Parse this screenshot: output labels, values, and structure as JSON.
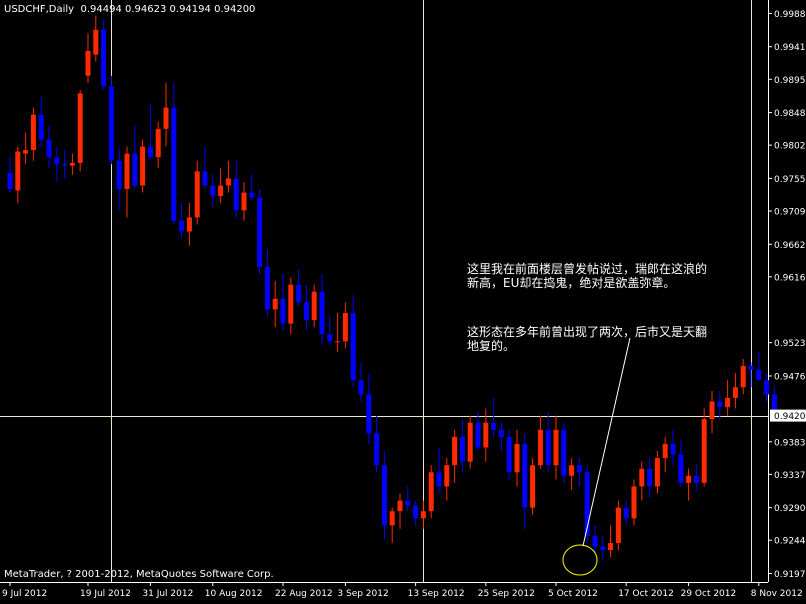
{
  "header": {
    "symbol": "USDCHF,Daily",
    "ohlc": "0.94494 0.94623 0.94194 0.94200"
  },
  "footer": {
    "copyright": "MetaTrader, ? 2001-2012, MetaQuotes Software Corp."
  },
  "annotations": {
    "note1": "这里我在前面楼层曾发帖说过，瑞郎在这浪的新高，EU却在捣鬼，绝对是欲盖弥章。",
    "note2": "这形态在多年前曾出现了两次，后市又是天翻地复的。"
  },
  "colors": {
    "background": "#000000",
    "bullish": "#ff2a00",
    "bearish": "#0000ff",
    "text": "#ffffff",
    "gridline": "#f0e6c8",
    "ellipse": "#ffff00"
  },
  "chart_data": {
    "type": "candlestick",
    "ylim": [
      0.9185,
      1.0007
    ],
    "y_ticks": [
      "0.99880",
      "0.99410",
      "0.98950",
      "0.98480",
      "0.98020",
      "0.97550",
      "0.97090",
      "0.96620",
      "0.96160",
      "0.95230",
      "0.94760",
      "0.93830",
      "0.93370",
      "0.92900",
      "0.92440",
      "0.91970"
    ],
    "current_price": "0.94200",
    "x_ticks": [
      {
        "label": "9 Jul 2012",
        "index": 0
      },
      {
        "label": "19 Jul 2012",
        "index": 10
      },
      {
        "label": "31 Jul 2012",
        "index": 18
      },
      {
        "label": "10 Aug 2012",
        "index": 26
      },
      {
        "label": "22 Aug 2012",
        "index": 35
      },
      {
        "label": "3 Sep 2012",
        "index": 43
      },
      {
        "label": "13 Sep 2012",
        "index": 52
      },
      {
        "label": "25 Sep 2012",
        "index": 61
      },
      {
        "label": "5 Oct 2012",
        "index": 70
      },
      {
        "label": "17 Oct 2012",
        "index": 79
      },
      {
        "label": "29 Oct 2012",
        "index": 87
      },
      {
        "label": "8 Nov 2012",
        "index": 96
      }
    ],
    "vertical_markers": [
      13,
      53,
      95
    ],
    "candles": [
      {
        "o": 0.9763,
        "h": 0.9785,
        "l": 0.9735,
        "c": 0.974
      },
      {
        "o": 0.9738,
        "h": 0.98,
        "l": 0.972,
        "c": 0.9793
      },
      {
        "o": 0.979,
        "h": 0.982,
        "l": 0.9775,
        "c": 0.9795
      },
      {
        "o": 0.9795,
        "h": 0.9855,
        "l": 0.978,
        "c": 0.9845
      },
      {
        "o": 0.9845,
        "h": 0.987,
        "l": 0.98,
        "c": 0.981
      },
      {
        "o": 0.981,
        "h": 0.983,
        "l": 0.977,
        "c": 0.9785
      },
      {
        "o": 0.9785,
        "h": 0.98,
        "l": 0.975,
        "c": 0.9775
      },
      {
        "o": 0.9775,
        "h": 0.9795,
        "l": 0.9755,
        "c": 0.9773
      },
      {
        "o": 0.9773,
        "h": 0.979,
        "l": 0.976,
        "c": 0.9777
      },
      {
        "o": 0.9777,
        "h": 0.988,
        "l": 0.9765,
        "c": 0.9875
      },
      {
        "o": 0.99,
        "h": 0.996,
        "l": 0.989,
        "c": 0.9935
      },
      {
        "o": 0.993,
        "h": 0.9985,
        "l": 0.992,
        "c": 0.9965
      },
      {
        "o": 0.9965,
        "h": 0.998,
        "l": 0.988,
        "c": 0.9885
      },
      {
        "o": 0.9885,
        "h": 0.99,
        "l": 0.9775,
        "c": 0.978
      },
      {
        "o": 0.978,
        "h": 0.98,
        "l": 0.971,
        "c": 0.974
      },
      {
        "o": 0.974,
        "h": 0.98,
        "l": 0.97,
        "c": 0.979
      },
      {
        "o": 0.979,
        "h": 0.983,
        "l": 0.974,
        "c": 0.9745
      },
      {
        "o": 0.9745,
        "h": 0.981,
        "l": 0.9735,
        "c": 0.98
      },
      {
        "o": 0.98,
        "h": 0.986,
        "l": 0.978,
        "c": 0.9785
      },
      {
        "o": 0.9785,
        "h": 0.9835,
        "l": 0.977,
        "c": 0.9825
      },
      {
        "o": 0.9825,
        "h": 0.989,
        "l": 0.98,
        "c": 0.9855
      },
      {
        "o": 0.9855,
        "h": 0.989,
        "l": 0.969,
        "c": 0.9695
      },
      {
        "o": 0.9695,
        "h": 0.972,
        "l": 0.967,
        "c": 0.968
      },
      {
        "o": 0.968,
        "h": 0.972,
        "l": 0.966,
        "c": 0.97
      },
      {
        "o": 0.97,
        "h": 0.978,
        "l": 0.969,
        "c": 0.9765
      },
      {
        "o": 0.9765,
        "h": 0.98,
        "l": 0.974,
        "c": 0.9745
      },
      {
        "o": 0.9745,
        "h": 0.976,
        "l": 0.9715,
        "c": 0.973
      },
      {
        "o": 0.973,
        "h": 0.977,
        "l": 0.972,
        "c": 0.9745
      },
      {
        "o": 0.9745,
        "h": 0.978,
        "l": 0.9735,
        "c": 0.9755
      },
      {
        "o": 0.9755,
        "h": 0.978,
        "l": 0.97,
        "c": 0.971
      },
      {
        "o": 0.971,
        "h": 0.975,
        "l": 0.9695,
        "c": 0.9735
      },
      {
        "o": 0.9735,
        "h": 0.976,
        "l": 0.9725,
        "c": 0.9728
      },
      {
        "o": 0.9728,
        "h": 0.974,
        "l": 0.962,
        "c": 0.963
      },
      {
        "o": 0.963,
        "h": 0.9655,
        "l": 0.956,
        "c": 0.957
      },
      {
        "o": 0.957,
        "h": 0.961,
        "l": 0.9545,
        "c": 0.9585
      },
      {
        "o": 0.9585,
        "h": 0.962,
        "l": 0.954,
        "c": 0.955
      },
      {
        "o": 0.955,
        "h": 0.9615,
        "l": 0.9535,
        "c": 0.9605
      },
      {
        "o": 0.9605,
        "h": 0.9625,
        "l": 0.9575,
        "c": 0.958
      },
      {
        "o": 0.958,
        "h": 0.9605,
        "l": 0.954,
        "c": 0.9555
      },
      {
        "o": 0.9555,
        "h": 0.9605,
        "l": 0.9545,
        "c": 0.9595
      },
      {
        "o": 0.9595,
        "h": 0.962,
        "l": 0.952,
        "c": 0.9535
      },
      {
        "o": 0.9535,
        "h": 0.956,
        "l": 0.952,
        "c": 0.9525
      },
      {
        "o": 0.9525,
        "h": 0.9565,
        "l": 0.951,
        "c": 0.9525
      },
      {
        "o": 0.9525,
        "h": 0.958,
        "l": 0.9515,
        "c": 0.9565
      },
      {
        "o": 0.9565,
        "h": 0.959,
        "l": 0.946,
        "c": 0.947
      },
      {
        "o": 0.947,
        "h": 0.9495,
        "l": 0.944,
        "c": 0.945
      },
      {
        "o": 0.945,
        "h": 0.948,
        "l": 0.938,
        "c": 0.9395
      },
      {
        "o": 0.9395,
        "h": 0.942,
        "l": 0.934,
        "c": 0.935
      },
      {
        "o": 0.935,
        "h": 0.937,
        "l": 0.9245,
        "c": 0.9265
      },
      {
        "o": 0.9265,
        "h": 0.929,
        "l": 0.924,
        "c": 0.9285
      },
      {
        "o": 0.9285,
        "h": 0.931,
        "l": 0.926,
        "c": 0.93
      },
      {
        "o": 0.93,
        "h": 0.932,
        "l": 0.9285,
        "c": 0.9293
      },
      {
        "o": 0.9293,
        "h": 0.93,
        "l": 0.9265,
        "c": 0.9275
      },
      {
        "o": 0.9275,
        "h": 0.93,
        "l": 0.926,
        "c": 0.9285
      },
      {
        "o": 0.9285,
        "h": 0.935,
        "l": 0.9275,
        "c": 0.934
      },
      {
        "o": 0.934,
        "h": 0.9375,
        "l": 0.931,
        "c": 0.932
      },
      {
        "o": 0.932,
        "h": 0.936,
        "l": 0.93,
        "c": 0.935
      },
      {
        "o": 0.935,
        "h": 0.94,
        "l": 0.9325,
        "c": 0.939
      },
      {
        "o": 0.939,
        "h": 0.9415,
        "l": 0.934,
        "c": 0.9355
      },
      {
        "o": 0.9355,
        "h": 0.942,
        "l": 0.9345,
        "c": 0.941
      },
      {
        "o": 0.941,
        "h": 0.9425,
        "l": 0.937,
        "c": 0.9375
      },
      {
        "o": 0.9375,
        "h": 0.943,
        "l": 0.9355,
        "c": 0.941
      },
      {
        "o": 0.941,
        "h": 0.9445,
        "l": 0.939,
        "c": 0.94
      },
      {
        "o": 0.94,
        "h": 0.941,
        "l": 0.937,
        "c": 0.939
      },
      {
        "o": 0.939,
        "h": 0.94,
        "l": 0.933,
        "c": 0.934
      },
      {
        "o": 0.934,
        "h": 0.94,
        "l": 0.932,
        "c": 0.938
      },
      {
        "o": 0.938,
        "h": 0.9395,
        "l": 0.926,
        "c": 0.929
      },
      {
        "o": 0.929,
        "h": 0.936,
        "l": 0.928,
        "c": 0.935
      },
      {
        "o": 0.935,
        "h": 0.942,
        "l": 0.9345,
        "c": 0.94
      },
      {
        "o": 0.94,
        "h": 0.9425,
        "l": 0.934,
        "c": 0.935
      },
      {
        "o": 0.935,
        "h": 0.942,
        "l": 0.933,
        "c": 0.94
      },
      {
        "o": 0.94,
        "h": 0.941,
        "l": 0.9325,
        "c": 0.9335
      },
      {
        "o": 0.9335,
        "h": 0.936,
        "l": 0.9315,
        "c": 0.935
      },
      {
        "o": 0.935,
        "h": 0.936,
        "l": 0.932,
        "c": 0.934
      },
      {
        "o": 0.934,
        "h": 0.935,
        "l": 0.924,
        "c": 0.925
      },
      {
        "o": 0.925,
        "h": 0.9265,
        "l": 0.9225,
        "c": 0.9235
      },
      {
        "o": 0.9235,
        "h": 0.925,
        "l": 0.9215,
        "c": 0.923
      },
      {
        "o": 0.923,
        "h": 0.9265,
        "l": 0.922,
        "c": 0.924
      },
      {
        "o": 0.924,
        "h": 0.93,
        "l": 0.923,
        "c": 0.929
      },
      {
        "o": 0.929,
        "h": 0.93,
        "l": 0.9265,
        "c": 0.9275
      },
      {
        "o": 0.9275,
        "h": 0.933,
        "l": 0.9265,
        "c": 0.932
      },
      {
        "o": 0.932,
        "h": 0.9355,
        "l": 0.93,
        "c": 0.9345
      },
      {
        "o": 0.9345,
        "h": 0.936,
        "l": 0.9305,
        "c": 0.932
      },
      {
        "o": 0.932,
        "h": 0.937,
        "l": 0.931,
        "c": 0.936
      },
      {
        "o": 0.936,
        "h": 0.939,
        "l": 0.934,
        "c": 0.938
      },
      {
        "o": 0.938,
        "h": 0.94,
        "l": 0.935,
        "c": 0.9365
      },
      {
        "o": 0.9365,
        "h": 0.9385,
        "l": 0.932,
        "c": 0.9325
      },
      {
        "o": 0.9325,
        "h": 0.9345,
        "l": 0.93,
        "c": 0.9335
      },
      {
        "o": 0.9335,
        "h": 0.935,
        "l": 0.9315,
        "c": 0.9325
      },
      {
        "o": 0.9325,
        "h": 0.943,
        "l": 0.932,
        "c": 0.9415
      },
      {
        "o": 0.9415,
        "h": 0.9455,
        "l": 0.9395,
        "c": 0.944
      },
      {
        "o": 0.944,
        "h": 0.9455,
        "l": 0.9415,
        "c": 0.9432
      },
      {
        "o": 0.9432,
        "h": 0.947,
        "l": 0.942,
        "c": 0.9445
      },
      {
        "o": 0.9445,
        "h": 0.948,
        "l": 0.943,
        "c": 0.946
      },
      {
        "o": 0.946,
        "h": 0.95,
        "l": 0.945,
        "c": 0.949
      },
      {
        "o": 0.949,
        "h": 0.9495,
        "l": 0.946,
        "c": 0.9485
      },
      {
        "o": 0.9485,
        "h": 0.951,
        "l": 0.947,
        "c": 0.947
      },
      {
        "o": 0.947,
        "h": 0.948,
        "l": 0.944,
        "c": 0.945
      },
      {
        "o": 0.945,
        "h": 0.9462,
        "l": 0.9419,
        "c": 0.942
      }
    ]
  }
}
